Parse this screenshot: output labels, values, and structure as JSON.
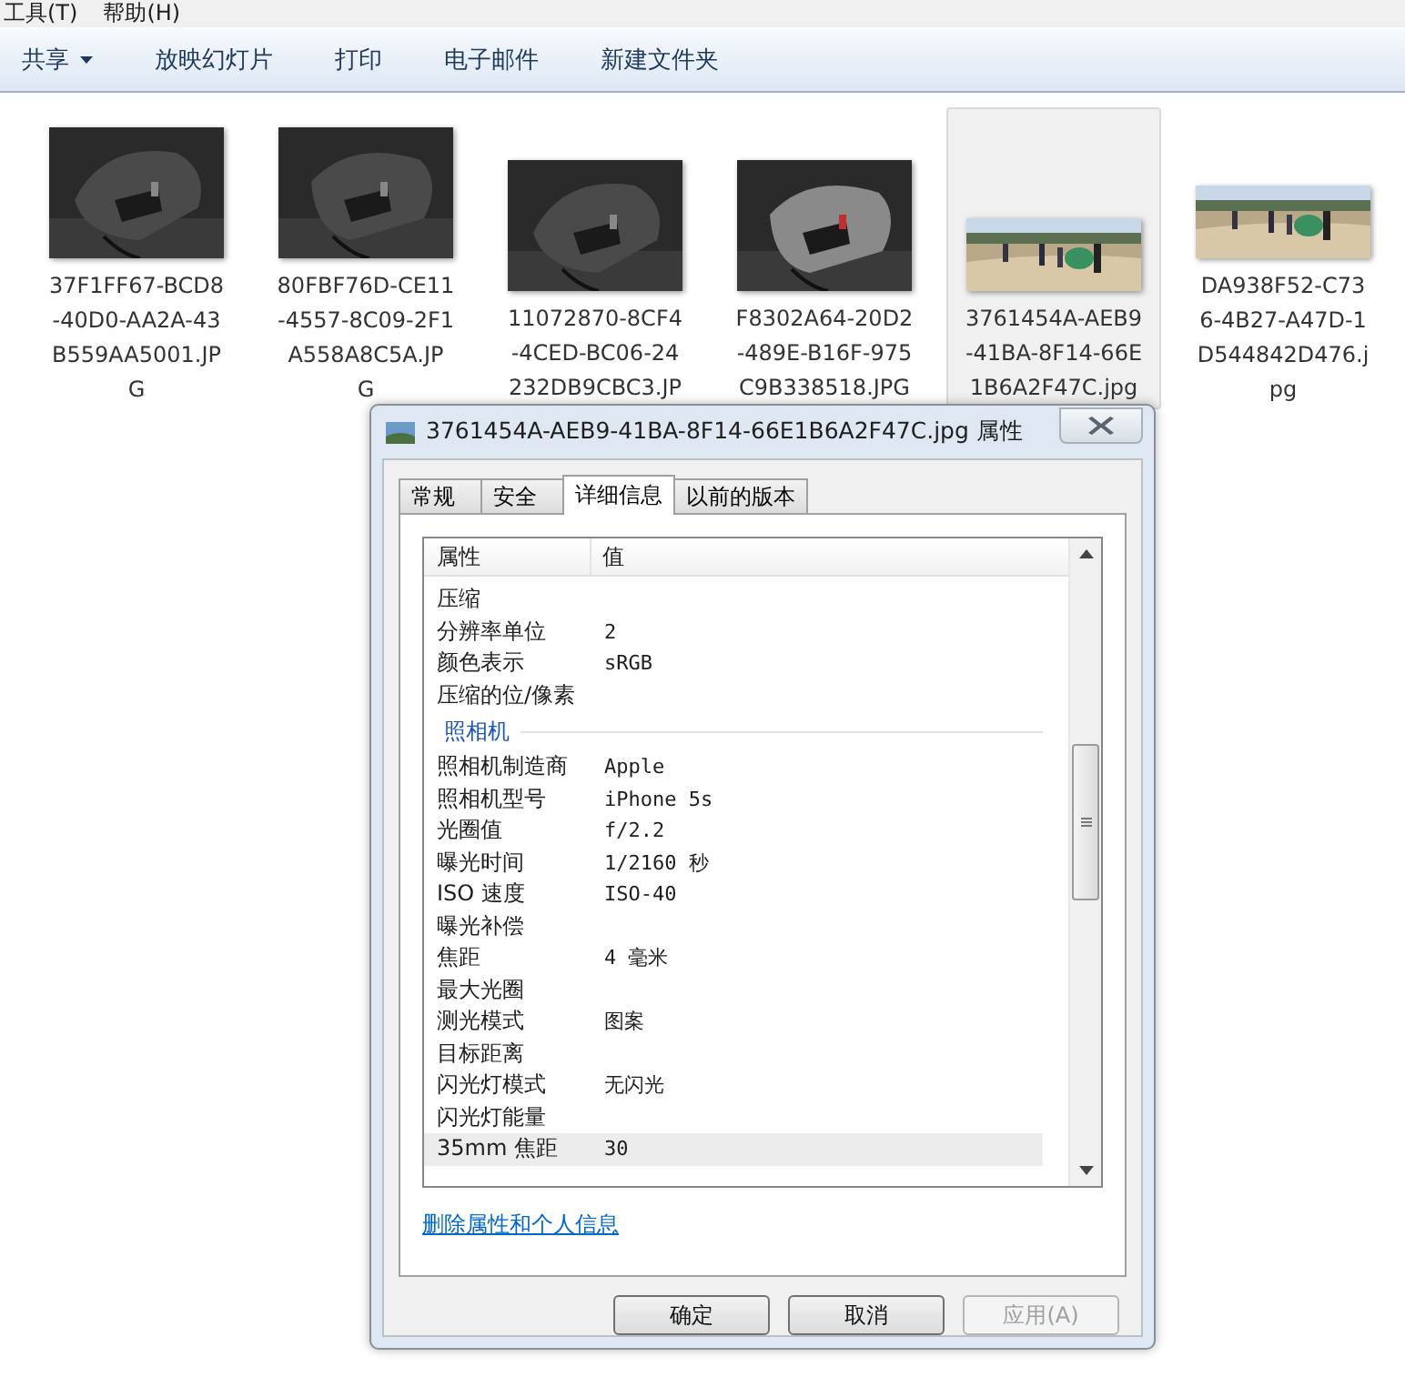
{
  "menu_bar": [
    "工具(T)",
    "帮助(H)"
  ],
  "toolbar": [
    {
      "label": "共享",
      "dropdown": true
    },
    {
      "label": "放映幻灯片",
      "dropdown": false
    },
    {
      "label": "打印",
      "dropdown": false
    },
    {
      "label": "电子邮件",
      "dropdown": false
    },
    {
      "label": "新建文件夹",
      "dropdown": false
    }
  ],
  "files": [
    {
      "name_lines": [
        "37F1FF67-BCD8",
        "-40D0-AA2A-43",
        "B559AA5001.JP",
        "G"
      ],
      "selected": false,
      "kind": "mouse"
    },
    {
      "name_lines": [
        "80FBF76D-CE11",
        "-4557-8C09-2F1",
        "A558A8C5A.JP",
        "G"
      ],
      "selected": false,
      "kind": "mouse"
    },
    {
      "name_lines": [
        "11072870-8CF4",
        "-4CED-BC06-24",
        "232DB9CBC3.JP"
      ],
      "selected": false,
      "kind": "mouse"
    },
    {
      "name_lines": [
        "F8302A64-20D2",
        "-489E-B16F-975",
        "C9B338518.JPG"
      ],
      "selected": false,
      "kind": "mouse"
    },
    {
      "name_lines": [
        "3761454A-AEB9",
        "-41BA-8F14-66E",
        "1B6A2F47C.jpg"
      ],
      "selected": true,
      "kind": "beach"
    },
    {
      "name_lines": [
        "DA938F52-C73",
        "6-4B27-A47D-1",
        "D544842D476.j",
        "pg"
      ],
      "selected": false,
      "kind": "beach"
    }
  ],
  "dialog": {
    "title": "3761454A-AEB9-41BA-8F14-66E1B6A2F47C.jpg 属性",
    "tabs": [
      {
        "label": "常规",
        "selected": false
      },
      {
        "label": "安全",
        "selected": false
      },
      {
        "label": "详细信息",
        "selected": true
      },
      {
        "label": "以前的版本",
        "selected": false
      }
    ],
    "columns": [
      "属性",
      "值"
    ],
    "rows": [
      {
        "kind": "row",
        "name": "压缩",
        "value": "",
        "selected": false
      },
      {
        "kind": "row",
        "name": "分辨率单位",
        "value": "2",
        "selected": false
      },
      {
        "kind": "row",
        "name": "颜色表示",
        "value": "sRGB",
        "selected": false
      },
      {
        "kind": "row",
        "name": "压缩的位/像素",
        "value": "",
        "selected": false
      },
      {
        "kind": "section",
        "name": "照相机"
      },
      {
        "kind": "row",
        "name": "照相机制造商",
        "value": "Apple",
        "selected": false
      },
      {
        "kind": "row",
        "name": "照相机型号",
        "value": "iPhone 5s",
        "selected": false
      },
      {
        "kind": "row",
        "name": "光圈值",
        "value": "f/2.2",
        "selected": false
      },
      {
        "kind": "row",
        "name": "曝光时间",
        "value": "1/2160 秒",
        "selected": false
      },
      {
        "kind": "row",
        "name": "ISO 速度",
        "value": "ISO-40",
        "selected": false
      },
      {
        "kind": "row",
        "name": "曝光补偿",
        "value": "",
        "selected": false
      },
      {
        "kind": "row",
        "name": "焦距",
        "value": "4 毫米",
        "selected": false
      },
      {
        "kind": "row",
        "name": "最大光圈",
        "value": "",
        "selected": false
      },
      {
        "kind": "row",
        "name": "测光模式",
        "value": "图案",
        "selected": false
      },
      {
        "kind": "row",
        "name": "目标距离",
        "value": "",
        "selected": false
      },
      {
        "kind": "row",
        "name": "闪光灯模式",
        "value": "无闪光",
        "selected": false
      },
      {
        "kind": "row",
        "name": "闪光灯能量",
        "value": "",
        "selected": false
      },
      {
        "kind": "row",
        "name": "35mm 焦距",
        "value": "30",
        "selected": true
      }
    ],
    "link": "删除属性和个人信息",
    "buttons": [
      {
        "label": "确定",
        "disabled": false
      },
      {
        "label": "取消",
        "disabled": false
      },
      {
        "label": "应用(A)",
        "disabled": true
      }
    ]
  }
}
